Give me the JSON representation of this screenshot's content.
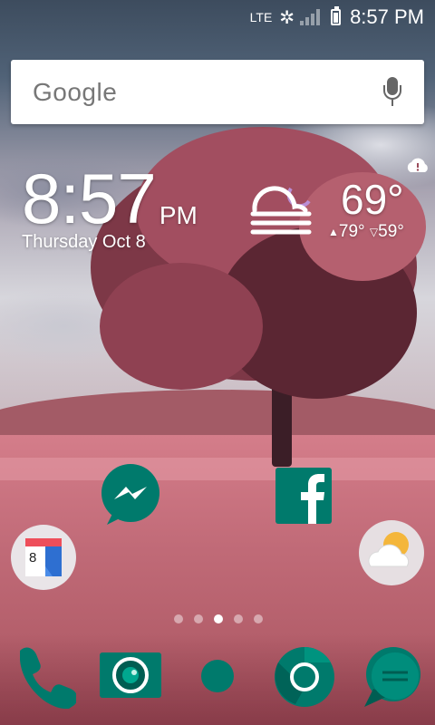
{
  "status_bar": {
    "network": "LTE",
    "time": "8:57 PM",
    "icons": [
      "lte-icon",
      "sync-icon",
      "signal-icon",
      "battery-icon"
    ]
  },
  "search": {
    "logo": "Google",
    "icon": "mic-icon"
  },
  "clock_widget": {
    "time": "8:57",
    "ampm": "PM",
    "date": "Thursday Oct 8"
  },
  "weather_widget": {
    "temp": "69°",
    "high": "79°",
    "low": "59°",
    "icon": "fog-moon-icon",
    "alert_icon": "cloud-alert-icon"
  },
  "home_apps": [
    {
      "id": "messenger",
      "icon": "messenger-icon"
    },
    {
      "id": "facebook",
      "icon": "facebook-icon"
    },
    {
      "id": "calendar",
      "icon": "calendar-icon",
      "badge": "8"
    },
    {
      "id": "weather",
      "icon": "weather-app-icon"
    }
  ],
  "page_indicator": {
    "count": 5,
    "active_index": 2
  },
  "dock": [
    "phone-icon",
    "camera-icon",
    "app-drawer-icon",
    "chrome-icon",
    "messages-icon"
  ],
  "colors": {
    "teal": "#007a6c",
    "teal_dark": "#005d52",
    "white": "#ffffff",
    "weather_moon": "#b98fd6"
  }
}
